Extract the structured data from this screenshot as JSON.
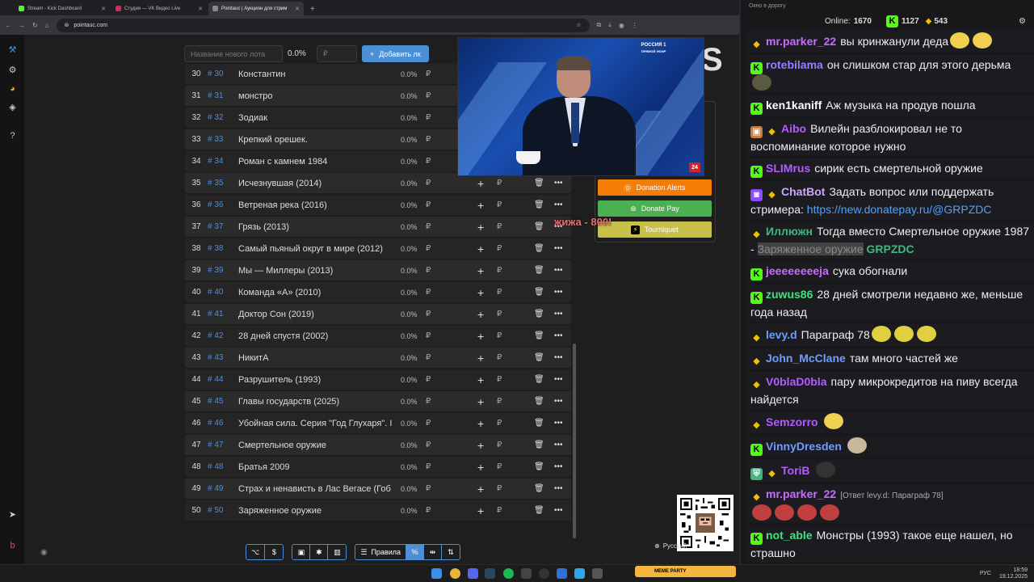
{
  "browser": {
    "tabs": [
      {
        "title": "Stream - Kick Dashboard",
        "color": "#53fc18",
        "active": false
      },
      {
        "title": "Студия — VK Видео Live",
        "color": "#e0245e",
        "active": false
      },
      {
        "title": "Pointauc | Аукцион для стрим",
        "color": "#888888",
        "active": true
      }
    ],
    "new_tab": "+",
    "url": "pointauc.com"
  },
  "form": {
    "lot_placeholder": "Название нового лота",
    "percent": "0.0%",
    "amount_placeholder": "₽",
    "add_button": "Добавить лк"
  },
  "lots": [
    {
      "n": "30",
      "id": "# 30",
      "name": "Константин"
    },
    {
      "n": "31",
      "id": "# 31",
      "name": " монстро"
    },
    {
      "n": "32",
      "id": "# 32",
      "name": "Зодиак"
    },
    {
      "n": "33",
      "id": "# 33",
      "name": "Крепкий орешек."
    },
    {
      "n": "34",
      "id": "# 34",
      "name": "Роман с камнем 1984"
    },
    {
      "n": "35",
      "id": "# 35",
      "name": "Исчезнувшая (2014)"
    },
    {
      "n": "36",
      "id": "# 36",
      "name": "Ветреная река (2016)"
    },
    {
      "n": "37",
      "id": "# 37",
      "name": "Грязь (2013)"
    },
    {
      "n": "38",
      "id": "# 38",
      "name": "Самый пьяный округ в мире (2012)"
    },
    {
      "n": "39",
      "id": "# 39",
      "name": "Мы — Миллеры (2013)"
    },
    {
      "n": "40",
      "id": "# 40",
      "name": "Команда «А» (2010)"
    },
    {
      "n": "41",
      "id": "# 41",
      "name": "Доктор Сон (2019)"
    },
    {
      "n": "42",
      "id": "# 42",
      "name": "28 дней спустя (2002)"
    },
    {
      "n": "43",
      "id": "# 43",
      "name": "НикитА"
    },
    {
      "n": "44",
      "id": "# 44",
      "name": "Разрушитель (1993)"
    },
    {
      "n": "45",
      "id": "# 45",
      "name": "Главы государств (2025)"
    },
    {
      "n": "46",
      "id": "# 46",
      "name": "Убойная сила. Серия \"Год Глухаря\". I"
    },
    {
      "n": "47",
      "id": "# 47",
      "name": "Смертельное оружие"
    },
    {
      "n": "48",
      "id": "# 48",
      "name": "Братья 2009"
    },
    {
      "n": "49",
      "id": "# 49",
      "name": "Страх и ненависть в Лас Вегасе (Гоб"
    },
    {
      "n": "50",
      "id": "# 50",
      "name": "Заряженное оружие"
    }
  ],
  "lot_percent": "0.0%",
  "currency": "₽",
  "donate": {
    "alerts": {
      "label": "Donation Alerts",
      "color": "#f57d07"
    },
    "pay": {
      "label": "Donate Pay",
      "color": "#4caf50"
    },
    "tourniquet": {
      "label": "Tourniquet",
      "color": "#c7c04a"
    }
  },
  "overlay_text": "жижа - 800!",
  "video": {
    "channel": "РОССИЯ 1",
    "live": "ПРЯМОЙ ЭФИР",
    "badge": "24"
  },
  "bottom_bar": {
    "rules": "Правила",
    "language": "Русский"
  },
  "chat": {
    "window_title": "Окно в дорогу",
    "online_label": "Online:",
    "online": "1670",
    "kick_count": "1127",
    "other_count": "543",
    "messages": [
      {
        "user": "mr.parker_22",
        "color": "#c86bff",
        "badge": "bird",
        "text": "вы кринжанули деда"
      },
      {
        "user": "rotebilama",
        "color": "#9b7bff",
        "badge": "kick",
        "text": "он слишком стар для этого дерьма"
      },
      {
        "user": "ken1kaniff",
        "color": "#ffffff",
        "badge": "kick",
        "text": "Аж музыка на продув пошла"
      },
      {
        "user": "Aibo",
        "color": "#b25cff",
        "badge": "gift",
        "text": "Вилейн разблокировал не то воспоминание которое нужно"
      },
      {
        "user": "SLIMrus",
        "color": "#b25cff",
        "badge": "kick",
        "text": "сирик есть смертельной оружие"
      },
      {
        "user": "ChatBot",
        "color": "#c9a6ff",
        "badge": "bot",
        "text": "Задать вопрос или поддержать стримера: ",
        "link": "https://new.donatepay.ru/@GRPZDC"
      },
      {
        "user": "Иллюжн",
        "color": "#43b581",
        "badge": "bird",
        "text": "Тогда вместо Смертельное оружие 1987 - ",
        "mark": "Заряженное оружие",
        "tail": "GRPZDC"
      },
      {
        "user": "jeeeeeeeeja",
        "color": "#c86bff",
        "badge": "kick",
        "text": "сука обогнали"
      },
      {
        "user": "zuwus86",
        "color": "#43e181",
        "badge": "kick",
        "text": "28 дней смотрели недавно же, меньше года назад"
      },
      {
        "user": "levy.d",
        "color": "#6f9cff",
        "badge": "bird",
        "text": "Параграф 78"
      },
      {
        "user": "John_McClane",
        "color": "#6f9cff",
        "badge": "bird",
        "text": "там много частей же"
      },
      {
        "user": "V0blaD0bla",
        "color": "#b25cff",
        "badge": "bird",
        "text": "пару микрокредитов на пиву всегда найдется"
      },
      {
        "user": "Semzorro",
        "color": "#b25cff",
        "badge": "bird",
        "text": ""
      },
      {
        "user": "VinnyDresden",
        "color": "#6f9cff",
        "badge": "kick",
        "text": ""
      },
      {
        "user": "ToriB",
        "color": "#b25cff",
        "badge": "shield",
        "text": ""
      },
      {
        "user": "mr.parker_22",
        "color": "#c86bff",
        "badge": "bird",
        "reply": "[Ответ levy.d: Параграф 78]",
        "text": ""
      },
      {
        "user": "not_able",
        "color": "#43e181",
        "badge": "kick",
        "text": "Монстры (1993) такое еще нашел, но страшно"
      }
    ]
  },
  "taskbar": {
    "time": "18:59",
    "date": "19.12.2025",
    "lang": "РУС",
    "kick_bar": "MEME PARTY"
  }
}
